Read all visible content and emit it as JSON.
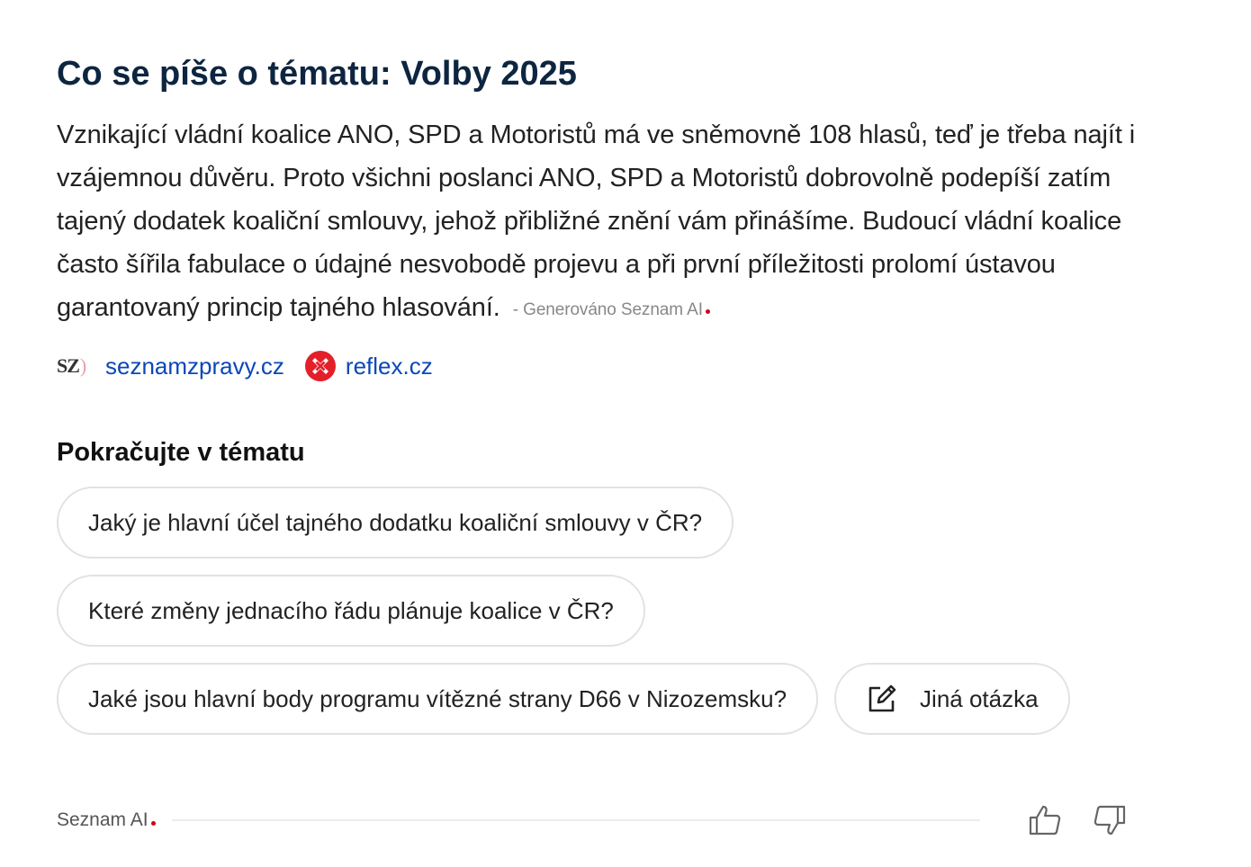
{
  "topic": {
    "title": "Co se píše o tématu: Volby 2025",
    "summary": "Vznikající vládní koalice ANO, SPD a Motoristů má ve sněmovně 108 hlasů, teď je třeba najít i vzájemnou důvěru. Proto všichni poslanci ANO, SPD a Motoristů dobrovolně podepíší zatím tajený dodatek koaliční smlouvy, jehož přibližné znění vám přinášíme. Budoucí vládní koalice často šířila fabulace o údajné nesvobodě projevu a při první příležitosti prolomí ústavou garantovaný princip tajného hlasování.",
    "generated_note": "- Generováno Seznam AI",
    "accent_color": "#d0021b",
    "title_color": "#0d2540",
    "link_color": "#0b47b8"
  },
  "sources": [
    {
      "label": "seznamzpravy.cz",
      "logo_text": "SZ",
      "logo_paren": ")",
      "icon": "seznamzpravy-logo-icon"
    },
    {
      "label": "reflex.cz",
      "icon": "reflex-logo-icon"
    }
  ],
  "continue": {
    "title": "Pokračujte v tématu",
    "questions": [
      "Jaký je hlavní účel tajného dodatku koaliční smlouvy v ČR?",
      "Které změny jednacího řádu plánuje koalice v ČR?",
      "Jaké jsou hlavní body programu vítězné strany D66 v Nizozemsku?"
    ],
    "other_question": "Jiná otázka",
    "other_icon": "edit-icon"
  },
  "footer": {
    "brand": "Seznam AI",
    "like_icon": "thumbs-up-icon",
    "dislike_icon": "thumbs-down-icon"
  }
}
